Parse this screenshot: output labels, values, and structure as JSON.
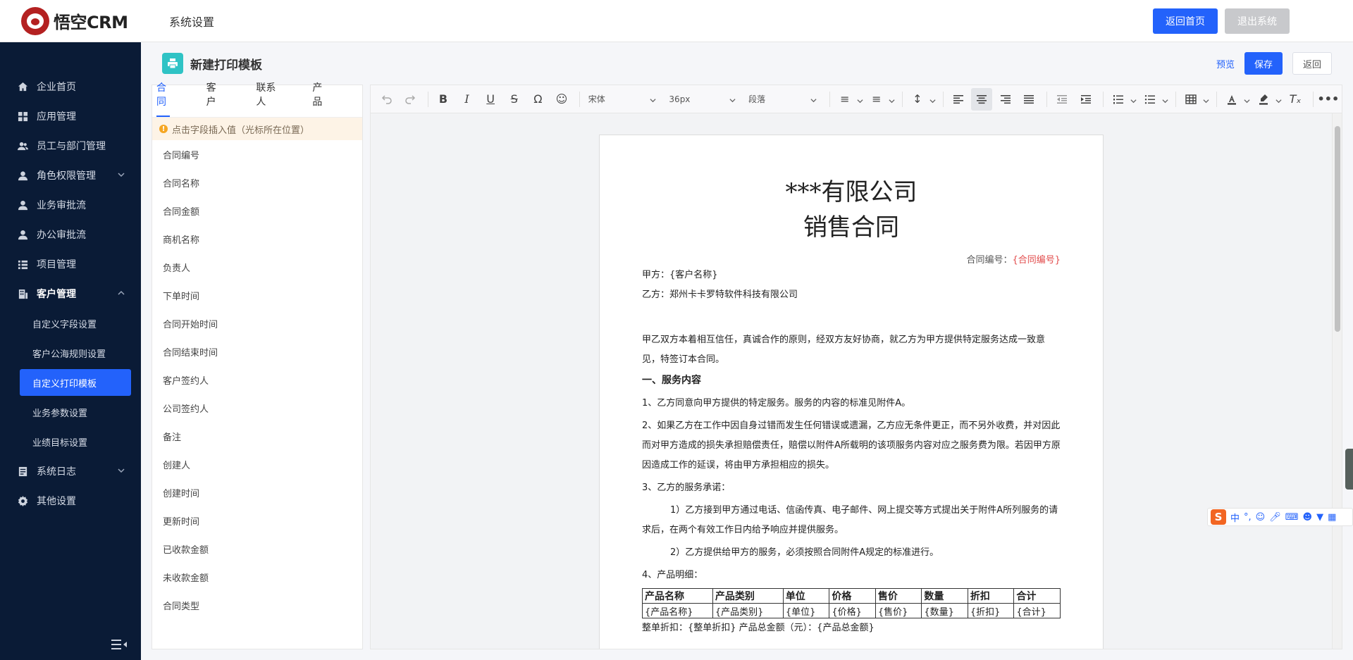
{
  "header": {
    "logo_text": "悟空CRM",
    "title": "系统设置",
    "back_home": "返回首页",
    "logout": "退出系统"
  },
  "sidebar": {
    "items": [
      {
        "label": "企业首页",
        "icon": "home-icon"
      },
      {
        "label": "应用管理",
        "icon": "grid-icon"
      },
      {
        "label": "员工与部门管理",
        "icon": "users-icon"
      },
      {
        "label": "角色权限管理",
        "icon": "user-icon",
        "has_children": true
      },
      {
        "label": "业务审批流",
        "icon": "person-icon"
      },
      {
        "label": "办公审批流",
        "icon": "person-icon"
      },
      {
        "label": "项目管理",
        "icon": "list-icon"
      },
      {
        "label": "客户管理",
        "icon": "building-icon",
        "expanded": true
      }
    ],
    "customer_sub": [
      {
        "label": "自定义字段设置"
      },
      {
        "label": "客户公海规则设置"
      },
      {
        "label": "自定义打印模板",
        "active": true
      },
      {
        "label": "业务参数设置"
      },
      {
        "label": "业绩目标设置"
      }
    ],
    "bottom_items": [
      {
        "label": "系统日志",
        "icon": "log-icon",
        "has_children": true
      },
      {
        "label": "其他设置",
        "icon": "gear-icon"
      }
    ]
  },
  "page": {
    "title": "新建打印模板",
    "preview": "预览",
    "save": "保存",
    "back": "返回"
  },
  "fields_panel": {
    "tabs": [
      "合同",
      "客户",
      "联系人",
      "产品"
    ],
    "active_tab": "合同",
    "tip": "点击字段插入值（光标所在位置）",
    "fields": [
      "合同编号",
      "合同名称",
      "合同金额",
      "商机名称",
      "负责人",
      "下单时间",
      "合同开始时间",
      "合同结束时间",
      "客户签约人",
      "公司签约人",
      "备注",
      "创建人",
      "创建时间",
      "更新时间",
      "已收款金额",
      "未收款金额",
      "合同类型"
    ]
  },
  "toolbar": {
    "font_family": "宋体",
    "font_size": "36px",
    "block_format": "段落"
  },
  "document": {
    "title_line1": "***有限公司",
    "title_line2": "销售合同",
    "contract_no_label": "合同编号：",
    "contract_no_value": "{合同编号}",
    "party_a": "甲方：{客户名称}",
    "party_b": "乙方：郑州卡卡罗特软件科技有限公司",
    "intro": "甲乙双方本着相互信任，真诚合作的原则，经双方友好协商，就乙方为甲方提供特定服务达成一致意见，特签订本合同。",
    "section1": "一、服务内容",
    "p1": "1、乙方同意向甲方提供的特定服务。服务的内容的标准见附件A。",
    "p2": "2、如果乙方在工作中因自身过错而发生任何错误或遗漏，乙方应无条件更正，而不另外收费，并对因此而对甲方造成的损失承担赔偿责任，赔偿以附件A所载明的该项服务内容对应之服务费为限。若因甲方原因造成工作的延误，将由甲方承担相应的损失。",
    "p3": "3、乙方的服务承诺：",
    "p3a": "1）乙方接到甲方通过电话、信函传真、电子邮件、网上提交等方式提出关于附件A所列服务的请求后，在两个有效工作日内给予响应并提供服务。",
    "p3b": "2）乙方提供给甲方的服务，必须按照合同附件A规定的标准进行。",
    "p4": "4、产品明细：",
    "table_headers": [
      "产品名称",
      "产品类别",
      "单位",
      "价格",
      "售价",
      "数量",
      "折扣",
      "合计"
    ],
    "table_row": [
      "{产品名称}",
      "{产品类别}",
      "{单位}",
      "{价格}",
      "{售价}",
      "{数量}",
      "{折扣}",
      "{合计}"
    ],
    "footer_line": "整单折扣：{整单折扣}        产品总金额（元）：{产品总金额}"
  },
  "ime": {
    "logo": "S",
    "lang": "中",
    "punct": "°,"
  }
}
